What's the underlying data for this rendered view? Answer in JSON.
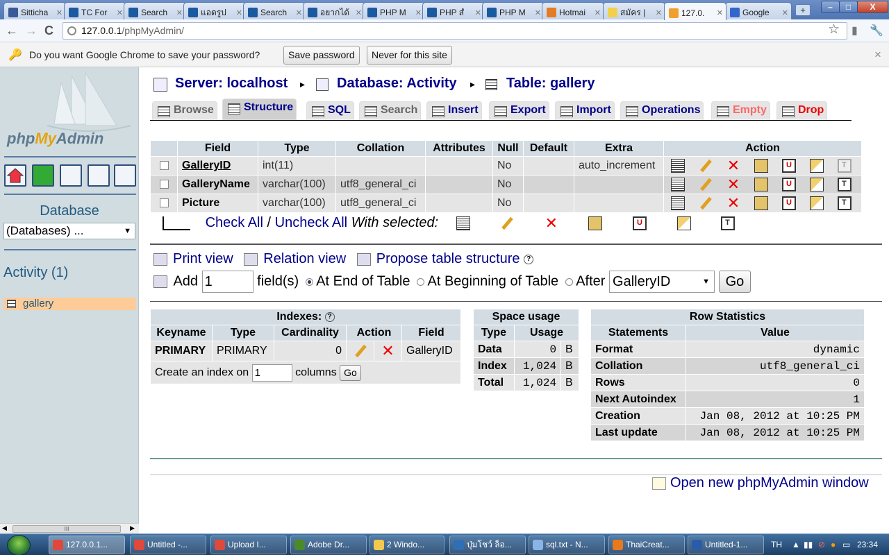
{
  "browser": {
    "tabs": [
      {
        "label": "Sitticha",
        "color": "#3b5998"
      },
      {
        "label": "TC For",
        "color": "#1a5aa0"
      },
      {
        "label": "Search",
        "color": "#1a5aa0"
      },
      {
        "label": "แอดรูป",
        "color": "#1a5aa0"
      },
      {
        "label": "Search",
        "color": "#1a5aa0"
      },
      {
        "label": "อยากได้",
        "color": "#1a5aa0"
      },
      {
        "label": "PHP M",
        "color": "#1a5aa0"
      },
      {
        "label": "PHP สํ",
        "color": "#1a5aa0"
      },
      {
        "label": "PHP M",
        "color": "#1a5aa0"
      },
      {
        "label": "Hotmai",
        "color": "#e37b24"
      },
      {
        "label": "สมัคร |",
        "color": "#f2d04a"
      },
      {
        "label": "127.0.",
        "color": "#f0a030"
      },
      {
        "label": "Google",
        "color": "#3366cc"
      }
    ],
    "new_tab_label": "+",
    "window_buttons": {
      "minimize": "–",
      "maximize": "□",
      "close": "X"
    },
    "url_host": "127.0.0.1",
    "url_path": "/phpMyAdmin/",
    "password_prompt": "Do you want Google Chrome to save your password?",
    "save_password": "Save password",
    "never_for_site": "Never for this site",
    "close_glyph": "×",
    "nav": {
      "back": "←",
      "forward": "→",
      "reload": "C",
      "star": "☆",
      "wrench": "🔧"
    }
  },
  "sidebar": {
    "logo_php": "php",
    "logo_my": "My",
    "logo_admin": "Admin",
    "database_label": "Database",
    "database_select": "(Databases) ...",
    "db_name": "Activity (1)",
    "tables": [
      "gallery"
    ],
    "scroll_grip": "III"
  },
  "breadcrumb": {
    "server": "Server: localhost",
    "database": "Database: Activity",
    "table": "Table: gallery",
    "arrow": "▸"
  },
  "tabs": [
    "Browse",
    "Structure",
    "SQL",
    "Search",
    "Insert",
    "Export",
    "Import",
    "Operations",
    "Empty",
    "Drop"
  ],
  "structure": {
    "headers": [
      "Field",
      "Type",
      "Collation",
      "Attributes",
      "Null",
      "Default",
      "Extra",
      "Action"
    ],
    "rows": [
      {
        "field": "GalleryID",
        "type": "int(11)",
        "collation": "",
        "attributes": "",
        "null": "No",
        "default": "",
        "extra": "auto_increment"
      },
      {
        "field": "GalleryName",
        "type": "varchar(100)",
        "collation": "utf8_general_ci",
        "attributes": "",
        "null": "No",
        "default": "",
        "extra": ""
      },
      {
        "field": "Picture",
        "type": "varchar(100)",
        "collation": "utf8_general_ci",
        "attributes": "",
        "null": "No",
        "default": "",
        "extra": ""
      }
    ]
  },
  "with_selected": {
    "check_all": "Check All",
    "separator": "/",
    "uncheck_all": "Uncheck All",
    "label": "With selected:"
  },
  "views": {
    "print": "Print view",
    "relation": "Relation view",
    "propose": "Propose table structure"
  },
  "add_field": {
    "label": "Add",
    "count": "1",
    "fields_label": "field(s)",
    "at_end": "At End of Table",
    "at_beginning": "At Beginning of Table",
    "after": "After",
    "after_field": "GalleryID",
    "go": "Go",
    "selected_position": "end"
  },
  "indexes": {
    "title": "Indexes:",
    "headers": [
      "Keyname",
      "Type",
      "Cardinality",
      "Action",
      "Field"
    ],
    "rows": [
      {
        "keyname": "PRIMARY",
        "type": "PRIMARY",
        "cardinality": "0",
        "field": "GalleryID"
      }
    ],
    "create_prefix": "Create an index on",
    "create_count": "1",
    "create_suffix": "columns",
    "go": "Go"
  },
  "space_usage": {
    "title": "Space usage",
    "headers": [
      "Type",
      "Usage"
    ],
    "rows": [
      {
        "type": "Data",
        "usage": "0",
        "unit": "B"
      },
      {
        "type": "Index",
        "usage": "1,024",
        "unit": "B"
      },
      {
        "type": "Total",
        "usage": "1,024",
        "unit": "B"
      }
    ]
  },
  "row_stats": {
    "title": "Row Statistics",
    "headers": [
      "Statements",
      "Value"
    ],
    "rows": [
      {
        "statement": "Format",
        "value": "dynamic"
      },
      {
        "statement": "Collation",
        "value": "utf8_general_ci"
      },
      {
        "statement": "Rows",
        "value": "0"
      },
      {
        "statement": "Next Autoindex",
        "value": "1"
      },
      {
        "statement": "Creation",
        "value": "Jan 08, 2012 at 10:25 PM"
      },
      {
        "statement": "Last update",
        "value": "Jan 08, 2012 at 10:25 PM"
      }
    ]
  },
  "open_new_window": "Open new phpMyAdmin window",
  "taskbar": {
    "items": [
      {
        "label": "127.0.0.1...",
        "color": "#e0483b"
      },
      {
        "label": "Untitled -...",
        "color": "#e0483b"
      },
      {
        "label": "Upload I...",
        "color": "#e0483b"
      },
      {
        "label": "Adobe Dr...",
        "color": "#4a8a2a"
      },
      {
        "label": "2 Windo...",
        "color": "#f2c94c"
      },
      {
        "label": "ปุ่มโชว์ ล็อ...",
        "color": "#2f6fb5"
      },
      {
        "label": "sql.txt - N...",
        "color": "#8ab4e8"
      },
      {
        "label": "ThaiCreat...",
        "color": "#e87a1d"
      },
      {
        "label": "Untitled-1...",
        "color": "#2a5ca8"
      }
    ],
    "lang": "TH",
    "clock": "23:34"
  }
}
